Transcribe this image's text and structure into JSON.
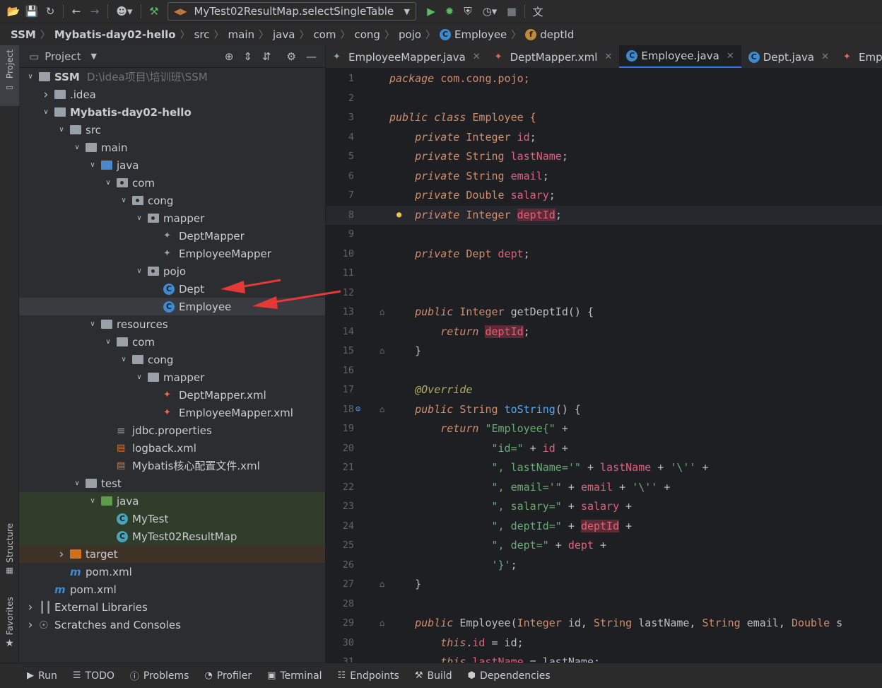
{
  "toolbar": {
    "run_config": "MyTest02ResultMap.selectSingleTable"
  },
  "breadcrumb": [
    "SSM",
    "Mybatis-day02-hello",
    "src",
    "main",
    "java",
    "com",
    "cong",
    "pojo",
    "Employee",
    "deptId"
  ],
  "side_tabs": {
    "project": "Project",
    "structure": "Structure",
    "favorites": "Favorites"
  },
  "project_panel": {
    "title": "Project",
    "tree": [
      {
        "label": "SSM",
        "path": "D:\\idea项目\\培训班\\SSM",
        "depth": 0,
        "toggle": "open",
        "icon": "module-folder",
        "bold": true
      },
      {
        "label": ".idea",
        "depth": 1,
        "toggle": "closed",
        "icon": "folder"
      },
      {
        "label": "Mybatis-day02-hello",
        "depth": 1,
        "toggle": "open",
        "icon": "module-folder",
        "bold": true
      },
      {
        "label": "src",
        "depth": 2,
        "toggle": "open",
        "icon": "folder"
      },
      {
        "label": "main",
        "depth": 3,
        "toggle": "open",
        "icon": "folder"
      },
      {
        "label": "java",
        "depth": 4,
        "toggle": "open",
        "icon": "source-folder"
      },
      {
        "label": "com",
        "depth": 5,
        "toggle": "open",
        "icon": "package"
      },
      {
        "label": "cong",
        "depth": 6,
        "toggle": "open",
        "icon": "package"
      },
      {
        "label": "mapper",
        "depth": 7,
        "toggle": "open",
        "icon": "package"
      },
      {
        "label": "DeptMapper",
        "depth": 8,
        "toggle": "none",
        "icon": "mapper"
      },
      {
        "label": "EmployeeMapper",
        "depth": 8,
        "toggle": "none",
        "icon": "mapper"
      },
      {
        "label": "pojo",
        "depth": 7,
        "toggle": "open",
        "icon": "package"
      },
      {
        "label": "Dept",
        "depth": 8,
        "toggle": "none",
        "icon": "class"
      },
      {
        "label": "Employee",
        "depth": 8,
        "toggle": "none",
        "icon": "class",
        "selected": true
      },
      {
        "label": "resources",
        "depth": 4,
        "toggle": "open",
        "icon": "resources-folder"
      },
      {
        "label": "com",
        "depth": 5,
        "toggle": "open",
        "icon": "folder"
      },
      {
        "label": "cong",
        "depth": 6,
        "toggle": "open",
        "icon": "folder"
      },
      {
        "label": "mapper",
        "depth": 7,
        "toggle": "open",
        "icon": "folder"
      },
      {
        "label": "DeptMapper.xml",
        "depth": 8,
        "toggle": "none",
        "icon": "mybatis-xml"
      },
      {
        "label": "EmployeeMapper.xml",
        "depth": 8,
        "toggle": "none",
        "icon": "mybatis-xml"
      },
      {
        "label": "jdbc.properties",
        "depth": 5,
        "toggle": "none",
        "icon": "properties"
      },
      {
        "label": "logback.xml",
        "depth": 5,
        "toggle": "none",
        "icon": "xml"
      },
      {
        "label": "Mybatis核心配置文件.xml",
        "depth": 5,
        "toggle": "none",
        "icon": "xml"
      },
      {
        "label": "test",
        "depth": 3,
        "toggle": "open",
        "icon": "folder"
      },
      {
        "label": "java",
        "depth": 4,
        "toggle": "open",
        "icon": "test-folder",
        "highlight": "green"
      },
      {
        "label": "MyTest",
        "depth": 5,
        "toggle": "none",
        "icon": "test-class",
        "highlight": "green"
      },
      {
        "label": "MyTest02ResultMap",
        "depth": 5,
        "toggle": "none",
        "icon": "test-class",
        "highlight": "green"
      },
      {
        "label": "target",
        "depth": 2,
        "toggle": "closed",
        "icon": "excluded-folder",
        "highlight": "brown"
      },
      {
        "label": "pom.xml",
        "depth": 2,
        "toggle": "none",
        "icon": "maven"
      },
      {
        "label": "pom.xml",
        "depth": 1,
        "toggle": "none",
        "icon": "maven"
      },
      {
        "label": "External Libraries",
        "depth": 0,
        "toggle": "closed",
        "icon": "libraries"
      },
      {
        "label": "Scratches and Consoles",
        "depth": 0,
        "toggle": "closed",
        "icon": "scratches"
      }
    ]
  },
  "editor": {
    "tabs": [
      {
        "label": "EmployeeMapper.java",
        "icon": "mapper",
        "active": false
      },
      {
        "label": "DeptMapper.xml",
        "icon": "mybatis-xml",
        "active": false
      },
      {
        "label": "Employee.java",
        "icon": "class",
        "active": true
      },
      {
        "label": "Dept.java",
        "icon": "class",
        "active": false
      },
      {
        "label": "Emplo",
        "icon": "mybatis-xml",
        "active": false
      }
    ],
    "current_line": 8,
    "lines": [
      {
        "n": "1",
        "runs": [
          [
            "package",
            "kw"
          ],
          [
            " com.cong.pojo;",
            "ty"
          ]
        ]
      },
      {
        "n": "2",
        "runs": []
      },
      {
        "n": "3",
        "runs": [
          [
            "public class",
            "kw"
          ],
          [
            " Employee {",
            "ty"
          ]
        ]
      },
      {
        "n": "4",
        "runs": [
          [
            "    "
          ],
          [
            "private",
            "kw"
          ],
          [
            " Integer ",
            "ty"
          ],
          [
            "id",
            "fd"
          ],
          [
            ";"
          ]
        ]
      },
      {
        "n": "5",
        "runs": [
          [
            "    "
          ],
          [
            "private",
            "kw"
          ],
          [
            " String ",
            "ty"
          ],
          [
            "lastName",
            "fd"
          ],
          [
            ";"
          ]
        ]
      },
      {
        "n": "6",
        "runs": [
          [
            "    "
          ],
          [
            "private",
            "kw"
          ],
          [
            " String ",
            "ty"
          ],
          [
            "email",
            "fd"
          ],
          [
            ";"
          ]
        ]
      },
      {
        "n": "7",
        "runs": [
          [
            "    "
          ],
          [
            "private",
            "kw"
          ],
          [
            " Double ",
            "ty"
          ],
          [
            "salary",
            "fd"
          ],
          [
            ";"
          ]
        ]
      },
      {
        "n": "8",
        "runs": [
          [
            "    "
          ],
          [
            "private",
            "kw"
          ],
          [
            " Integer ",
            "ty"
          ],
          [
            "deptId",
            "fd hl"
          ],
          [
            ";"
          ]
        ]
      },
      {
        "n": "9",
        "runs": []
      },
      {
        "n": "10",
        "runs": [
          [
            "    "
          ],
          [
            "private",
            "kw"
          ],
          [
            " Dept ",
            "ty"
          ],
          [
            "dept",
            "fd"
          ],
          [
            ";"
          ]
        ]
      },
      {
        "n": "11",
        "runs": []
      },
      {
        "n": "12",
        "runs": []
      },
      {
        "n": "13",
        "runs": [
          [
            "    "
          ],
          [
            "public",
            "kw"
          ],
          [
            " Integer ",
            "ty"
          ],
          [
            "getDeptId"
          ],
          [
            "() {"
          ]
        ]
      },
      {
        "n": "14",
        "runs": [
          [
            "        "
          ],
          [
            "return",
            "kw"
          ],
          [
            " "
          ],
          [
            "deptId",
            "fd hl"
          ],
          [
            ";"
          ]
        ]
      },
      {
        "n": "15",
        "runs": [
          [
            "    }"
          ]
        ]
      },
      {
        "n": "16",
        "runs": []
      },
      {
        "n": "17",
        "runs": [
          [
            "    "
          ],
          [
            "@Override",
            "an"
          ]
        ]
      },
      {
        "n": "18",
        "runs": [
          [
            "    "
          ],
          [
            "public",
            "kw"
          ],
          [
            " String ",
            "ty"
          ],
          [
            "toString",
            "fn"
          ],
          [
            "() {"
          ]
        ]
      },
      {
        "n": "19",
        "runs": [
          [
            "        "
          ],
          [
            "return",
            "kw"
          ],
          [
            " "
          ],
          [
            "\"Employee{\"",
            "str"
          ],
          [
            " +"
          ]
        ]
      },
      {
        "n": "20",
        "runs": [
          [
            "                "
          ],
          [
            "\"id=\"",
            "str"
          ],
          [
            " + "
          ],
          [
            "id",
            "fd"
          ],
          [
            " +"
          ]
        ]
      },
      {
        "n": "21",
        "runs": [
          [
            "                "
          ],
          [
            "\", lastName='\"",
            "str"
          ],
          [
            " + "
          ],
          [
            "lastName",
            "fd"
          ],
          [
            " + "
          ],
          [
            "'\\''",
            "str"
          ],
          [
            " +"
          ]
        ]
      },
      {
        "n": "22",
        "runs": [
          [
            "                "
          ],
          [
            "\", email='\"",
            "str"
          ],
          [
            " + "
          ],
          [
            "email",
            "fd"
          ],
          [
            " + "
          ],
          [
            "'\\''",
            "str"
          ],
          [
            " +"
          ]
        ]
      },
      {
        "n": "23",
        "runs": [
          [
            "                "
          ],
          [
            "\", salary=\"",
            "str"
          ],
          [
            " + "
          ],
          [
            "salary",
            "fd"
          ],
          [
            " +"
          ]
        ]
      },
      {
        "n": "24",
        "runs": [
          [
            "                "
          ],
          [
            "\", deptId=\"",
            "str"
          ],
          [
            " + "
          ],
          [
            "deptId",
            "fd hl"
          ],
          [
            " +"
          ]
        ]
      },
      {
        "n": "25",
        "runs": [
          [
            "                "
          ],
          [
            "\", dept=\"",
            "str"
          ],
          [
            " + "
          ],
          [
            "dept",
            "fd"
          ],
          [
            " +"
          ]
        ]
      },
      {
        "n": "26",
        "runs": [
          [
            "                "
          ],
          [
            "'}'",
            "str"
          ],
          [
            ";"
          ]
        ]
      },
      {
        "n": "27",
        "runs": [
          [
            "    }"
          ]
        ]
      },
      {
        "n": "28",
        "runs": []
      },
      {
        "n": "29",
        "runs": [
          [
            "    "
          ],
          [
            "public",
            "kw"
          ],
          [
            " Employee("
          ],
          [
            "Integer",
            "ty"
          ],
          [
            " id, "
          ],
          [
            "String",
            "ty"
          ],
          [
            " lastName, "
          ],
          [
            "String",
            "ty"
          ],
          [
            " email, "
          ],
          [
            "Double",
            "ty"
          ],
          [
            " s"
          ]
        ]
      },
      {
        "n": "30",
        "runs": [
          [
            "        "
          ],
          [
            "this",
            "kw"
          ],
          [
            "."
          ],
          [
            "id",
            "fd"
          ],
          [
            " = id;"
          ]
        ]
      },
      {
        "n": "31",
        "runs": [
          [
            "        "
          ],
          [
            "this",
            "kw"
          ],
          [
            "."
          ],
          [
            "lastName",
            "fd"
          ],
          [
            " = lastName;"
          ]
        ]
      }
    ]
  },
  "bottom_tools": [
    {
      "label": "Run",
      "icon": "run-icon"
    },
    {
      "label": "TODO",
      "icon": "todo-icon"
    },
    {
      "label": "Problems",
      "icon": "problems-icon"
    },
    {
      "label": "Profiler",
      "icon": "profiler-icon"
    },
    {
      "label": "Terminal",
      "icon": "terminal-icon"
    },
    {
      "label": "Endpoints",
      "icon": "endpoints-icon"
    },
    {
      "label": "Build",
      "icon": "build-icon"
    },
    {
      "label": "Dependencies",
      "icon": "dependencies-icon"
    }
  ],
  "annotation_color": "#e53935"
}
